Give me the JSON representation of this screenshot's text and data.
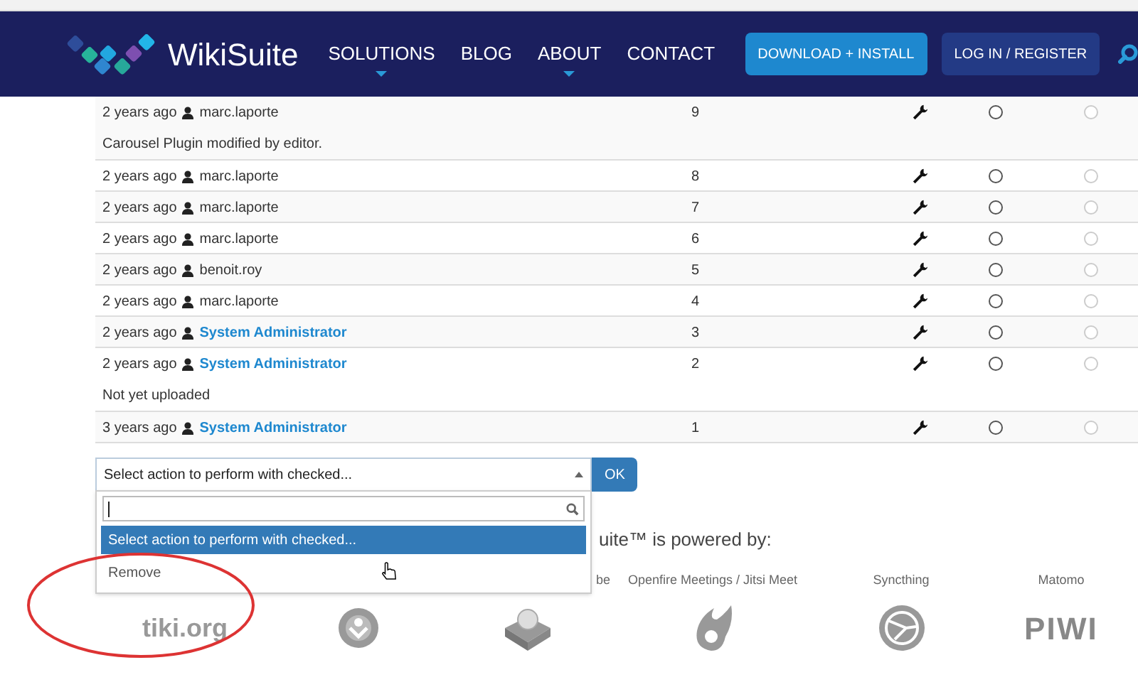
{
  "header": {
    "logo_text": "WikiSuite",
    "nav": [
      {
        "label": "SOLUTIONS",
        "has_menu": true
      },
      {
        "label": "BLOG",
        "has_menu": false
      },
      {
        "label": "ABOUT",
        "has_menu": true
      },
      {
        "label": "CONTACT",
        "has_menu": false
      }
    ],
    "buttons": [
      {
        "label": "DOWNLOAD + INSTALL",
        "kind": "primary"
      },
      {
        "label": "LOG IN / REGISTER",
        "kind": "secondary"
      }
    ]
  },
  "history": [
    {
      "age": "2 years ago",
      "user": "marc.laporte",
      "user_is_link": false,
      "version": "9",
      "comment": "Carousel Plugin modified by editor.",
      "radios": [
        {
          "checked": false,
          "disabled": false
        },
        {
          "checked": false,
          "disabled": true
        }
      ]
    },
    {
      "age": "2 years ago",
      "user": "marc.laporte",
      "user_is_link": false,
      "version": "8",
      "radios": [
        {
          "checked": false,
          "disabled": false
        },
        {
          "checked": false,
          "disabled": true
        }
      ]
    },
    {
      "age": "2 years ago",
      "user": "marc.laporte",
      "user_is_link": false,
      "version": "7",
      "radios": [
        {
          "checked": false,
          "disabled": false
        },
        {
          "checked": false,
          "disabled": true
        }
      ]
    },
    {
      "age": "2 years ago",
      "user": "marc.laporte",
      "user_is_link": false,
      "version": "6",
      "radios": [
        {
          "checked": false,
          "disabled": false
        },
        {
          "checked": false,
          "disabled": true
        }
      ]
    },
    {
      "age": "2 years ago",
      "user": "benoit.roy",
      "user_is_link": false,
      "version": "5",
      "radios": [
        {
          "checked": false,
          "disabled": false
        },
        {
          "checked": false,
          "disabled": true
        }
      ]
    },
    {
      "age": "2 years ago",
      "user": "marc.laporte",
      "user_is_link": false,
      "version": "4",
      "radios": [
        {
          "checked": false,
          "disabled": false
        },
        {
          "checked": false,
          "disabled": true
        }
      ]
    },
    {
      "age": "2 years ago",
      "user": "System Administrator",
      "user_is_link": true,
      "version": "3",
      "radios": [
        {
          "checked": false,
          "disabled": false
        },
        {
          "checked": false,
          "disabled": true
        }
      ]
    },
    {
      "age": "2 years ago",
      "user": "System Administrator",
      "user_is_link": true,
      "version": "2",
      "comment": "Not yet uploaded",
      "radios": [
        {
          "checked": false,
          "disabled": false
        },
        {
          "checked": false,
          "disabled": true
        }
      ]
    },
    {
      "age": "3 years ago",
      "user": "System Administrator",
      "user_is_link": true,
      "version": "1",
      "radios": [
        {
          "checked": false,
          "disabled": false
        },
        {
          "checked": false,
          "disabled": true
        }
      ]
    }
  ],
  "bulk_action": {
    "value": "Select action to perform with checked...",
    "ok": "OK",
    "expanded": true,
    "options": [
      {
        "label": "Select action to perform with checked...",
        "selected": true
      },
      {
        "label": "Remove",
        "selected": false
      }
    ]
  },
  "powered_by": {
    "heading": "uite™ is powered by:",
    "projects": [
      {
        "kind": "tiki",
        "logo_text": "tiki.org"
      },
      {
        "kind": "ring"
      },
      {
        "label": "be",
        "kind": "box"
      },
      {
        "label": "Openfire Meetings / Jitsi Meet",
        "kind": "flame"
      },
      {
        "label": "Syncthing",
        "kind": "sync"
      },
      {
        "label": "Matomo",
        "kind": "text",
        "logo_text": "PIWI"
      }
    ]
  }
}
